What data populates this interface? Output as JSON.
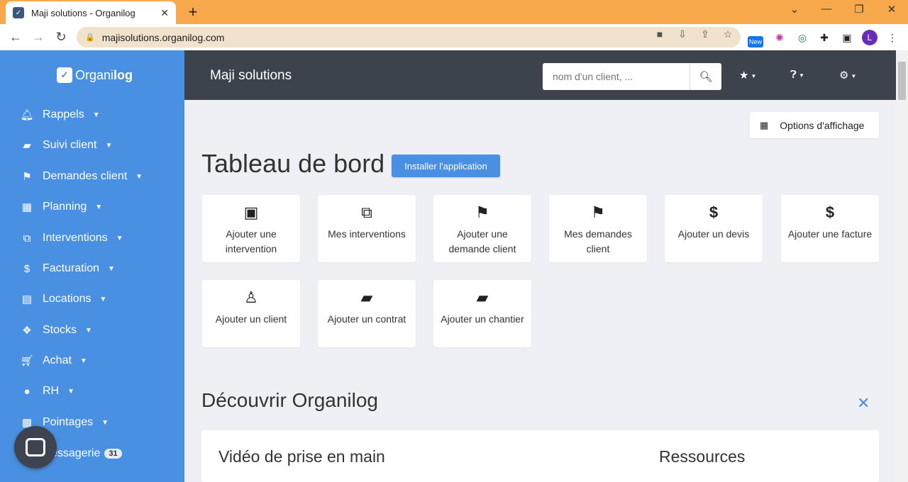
{
  "browser": {
    "tab_title": "Maji solutions - Organilog",
    "url": "majisolutions.organilog.com",
    "ext_new_label": "New",
    "profile_initial": "L"
  },
  "sidebar": {
    "logo_text_a": "Organi",
    "logo_text_b": "log",
    "items": [
      {
        "label": "Rappels",
        "icon": "bell-icon"
      },
      {
        "label": "Suivi client",
        "icon": "folder-open-icon"
      },
      {
        "label": "Demandes client",
        "icon": "flag-icon"
      },
      {
        "label": "Planning",
        "icon": "calendar-icon"
      },
      {
        "label": "Interventions",
        "icon": "copy-icon"
      },
      {
        "label": "Facturation",
        "icon": "dollar-icon"
      },
      {
        "label": "Locations",
        "icon": "briefcase-icon"
      },
      {
        "label": "Stocks",
        "icon": "cubes-icon"
      },
      {
        "label": "Achat",
        "icon": "cart-icon"
      },
      {
        "label": "RH",
        "icon": "user-icon"
      },
      {
        "label": "Pointages",
        "icon": "qrcode-icon"
      },
      {
        "label": "essagerie",
        "icon": "envelope-icon",
        "badge": "31"
      }
    ]
  },
  "header": {
    "company": "Maji solutions",
    "search_placeholder": "nom d'un client, ..."
  },
  "main": {
    "options_label": "Options d'affichage",
    "title": "Tableau de bord",
    "install_label": "Installer l'application",
    "shortcuts": [
      {
        "label": "Ajouter une intervention",
        "icon": "file-copy-icon"
      },
      {
        "label": "Mes interventions",
        "icon": "copy-icon"
      },
      {
        "label": "Ajouter une demande client",
        "icon": "flag-icon"
      },
      {
        "label": "Mes demandes client",
        "icon": "flag-icon"
      },
      {
        "label": "Ajouter un devis",
        "icon": "dollar-icon"
      },
      {
        "label": "Ajouter une facture",
        "icon": "dollar-icon"
      },
      {
        "label": "Ajouter un client",
        "icon": "user-outline-icon"
      },
      {
        "label": "Ajouter un contrat",
        "icon": "folder-open-icon"
      },
      {
        "label": "Ajouter un chantier",
        "icon": "folder-open-icon"
      }
    ],
    "discover_title": "Découvrir Organilog",
    "video_title": "Vidéo de prise en main",
    "resources_title": "Ressources"
  }
}
